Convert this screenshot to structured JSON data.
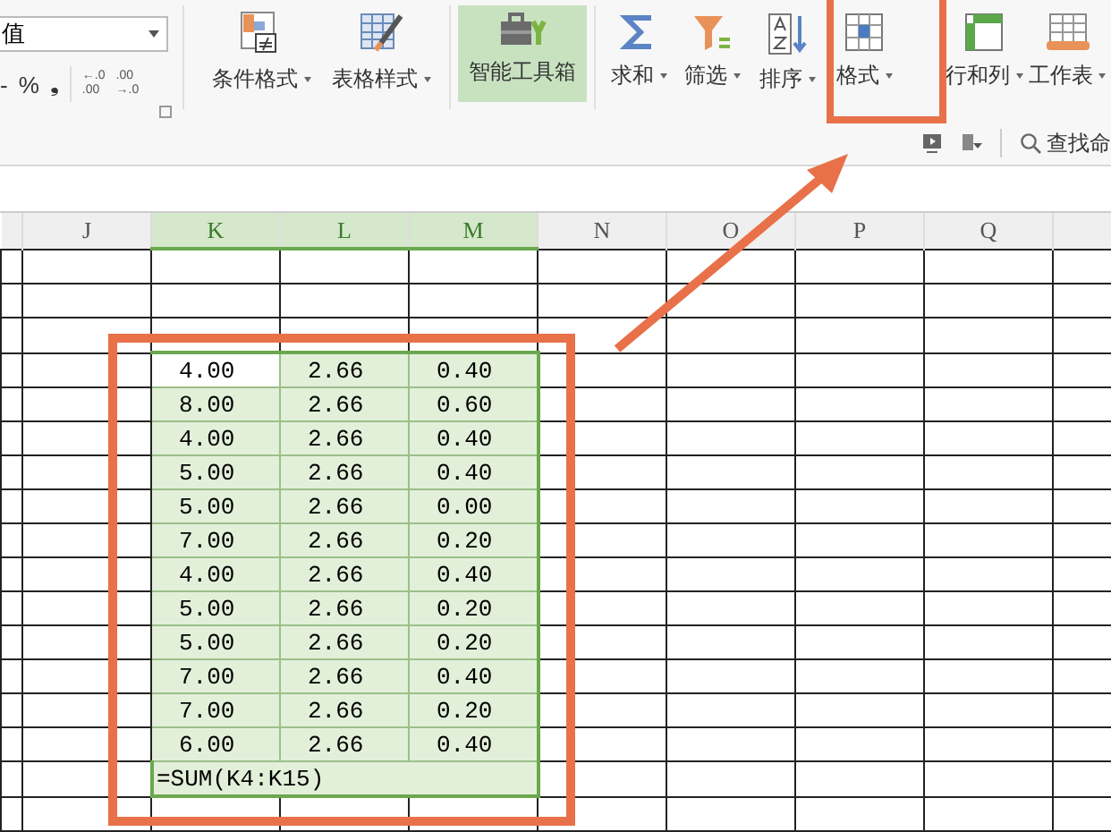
{
  "ribbon": {
    "number_format": {
      "value": "值"
    },
    "number_buttons": [
      {
        "label": "-"
      },
      {
        "label": "%"
      },
      {
        "label": "❟"
      }
    ],
    "decimal_buttons": [
      {
        "lines": [
          "←.0",
          ".00"
        ]
      },
      {
        "lines": [
          ".00",
          "→.0"
        ]
      }
    ],
    "tools": [
      {
        "label": "条件格式",
        "dropdown": true,
        "highlighted": false
      },
      {
        "label": "表格样式",
        "dropdown": true,
        "highlighted": false
      },
      {
        "label": "智能工具箱",
        "dropdown": false,
        "highlighted": true
      },
      {
        "label": "求和",
        "dropdown": true,
        "highlighted": false
      },
      {
        "label": "筛选",
        "dropdown": true,
        "highlighted": false
      },
      {
        "label": "排序",
        "dropdown": true,
        "highlighted": false
      },
      {
        "label": "格式",
        "dropdown": true,
        "highlighted": false
      },
      {
        "label": "行和列",
        "dropdown": true,
        "highlighted": false
      },
      {
        "label": "工作表",
        "dropdown": true,
        "highlighted": false
      }
    ],
    "search": {
      "label": "查找命"
    }
  },
  "sheet": {
    "columns": [
      {
        "label": "J",
        "selected": false
      },
      {
        "label": "K",
        "selected": true
      },
      {
        "label": "L",
        "selected": true
      },
      {
        "label": "M",
        "selected": true
      },
      {
        "label": "N",
        "selected": false
      },
      {
        "label": "O",
        "selected": false
      },
      {
        "label": "P",
        "selected": false
      },
      {
        "label": "Q",
        "selected": false
      }
    ],
    "rows": [
      {
        "kind": "blank"
      },
      {
        "kind": "blank"
      },
      {
        "kind": "blank"
      },
      {
        "kind": "data",
        "active": true,
        "cells": [
          "4.00",
          "2.66",
          "0.40"
        ]
      },
      {
        "kind": "data",
        "active": false,
        "cells": [
          "8.00",
          "2.66",
          "0.60"
        ]
      },
      {
        "kind": "data",
        "active": false,
        "cells": [
          "4.00",
          "2.66",
          "0.40"
        ]
      },
      {
        "kind": "data",
        "active": false,
        "cells": [
          "5.00",
          "2.66",
          "0.40"
        ]
      },
      {
        "kind": "data",
        "active": false,
        "cells": [
          "5.00",
          "2.66",
          "0.00"
        ]
      },
      {
        "kind": "data",
        "active": false,
        "cells": [
          "7.00",
          "2.66",
          "0.20"
        ]
      },
      {
        "kind": "data",
        "active": false,
        "cells": [
          "4.00",
          "2.66",
          "0.40"
        ]
      },
      {
        "kind": "data",
        "active": false,
        "cells": [
          "5.00",
          "2.66",
          "0.20"
        ]
      },
      {
        "kind": "data",
        "active": false,
        "cells": [
          "5.00",
          "2.66",
          "0.20"
        ]
      },
      {
        "kind": "data",
        "active": false,
        "cells": [
          "7.00",
          "2.66",
          "0.40"
        ]
      },
      {
        "kind": "data",
        "active": false,
        "cells": [
          "7.00",
          "2.66",
          "0.20"
        ]
      },
      {
        "kind": "data",
        "active": false,
        "cells": [
          "6.00",
          "2.66",
          "0.40"
        ]
      },
      {
        "kind": "formula",
        "text": "=SUM(K4:K15)"
      },
      {
        "kind": "blank"
      }
    ]
  }
}
